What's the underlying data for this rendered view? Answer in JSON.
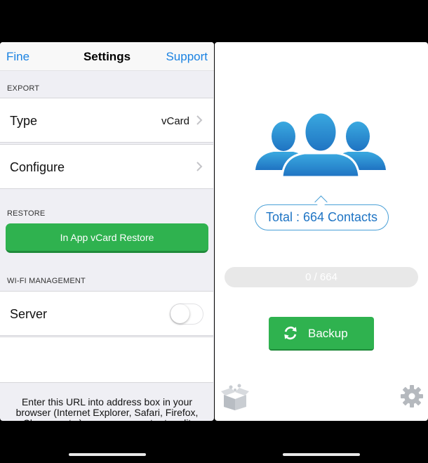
{
  "left": {
    "nav": {
      "left": "Fine",
      "title": "Settings",
      "right": "Support"
    },
    "sections": {
      "export": "EXPORT",
      "restore": "RESTORE",
      "wifi": "WI-FI MANAGEMENT"
    },
    "type_cell": {
      "label": "Type",
      "value": "vCard"
    },
    "configure_cell": {
      "label": "Configure"
    },
    "restore_button": "In App vCard Restore",
    "server_cell": {
      "label": "Server",
      "toggle_on": false
    },
    "note": "Enter this URL into address box in your browser (Internet Explorer, Safari, Firefox, Chrome, etc.) on your computer to edit"
  },
  "right": {
    "total": "Total : 664 Contacts",
    "progress": {
      "text": "0 / 664",
      "fraction": 0
    },
    "backup_button": "Backup",
    "icons": {
      "people": "contacts-group-icon",
      "box": "box-icon",
      "gear": "gear-icon"
    }
  },
  "colors": {
    "accent_blue": "#1a82e2",
    "green": "#2fb24f",
    "people_blue": "#2a8fd0"
  }
}
